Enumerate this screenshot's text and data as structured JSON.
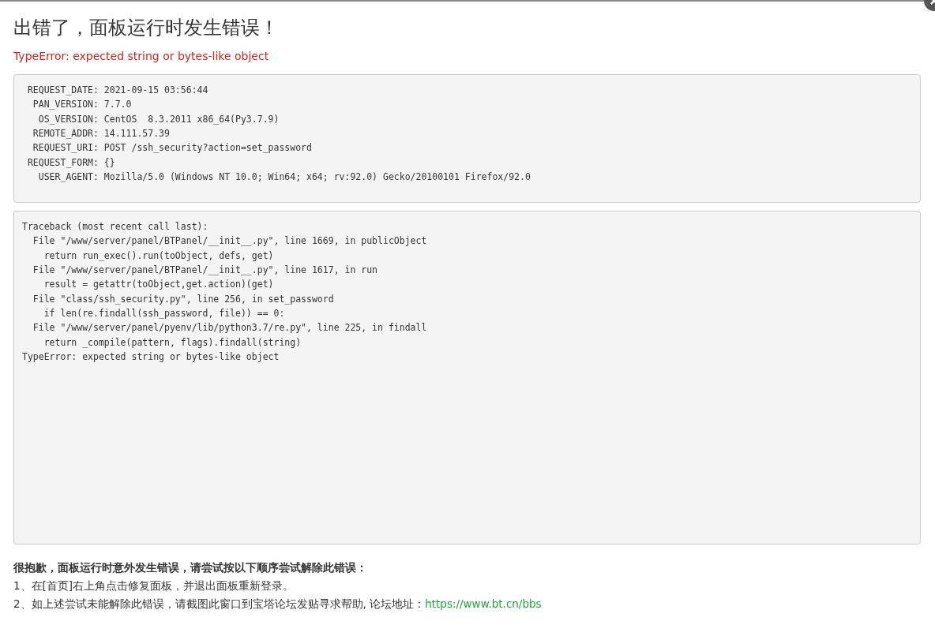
{
  "title": "出错了，面板运行时发生错误！",
  "error_message": "TypeError: expected string or bytes-like object",
  "request_info": [
    " REQUEST_DATE: 2021-09-15 03:56:44",
    "  PAN_VERSION: 7.7.0",
    "   OS_VERSION: CentOS  8.3.2011 x86_64(Py3.7.9)",
    "  REMOTE_ADDR: 14.111.57.39",
    "  REQUEST_URI: POST /ssh_security?action=set_password",
    " REQUEST_FORM: {}",
    "   USER_AGENT: Mozilla/5.0 (Windows NT 10.0; Win64; x64; rv:92.0) Gecko/20100101 Firefox/92.0"
  ],
  "traceback": [
    "Traceback (most recent call last):",
    "  File \"/www/server/panel/BTPanel/__init__.py\", line 1669, in publicObject",
    "    return run_exec().run(toObject, defs, get)",
    "  File \"/www/server/panel/BTPanel/__init__.py\", line 1617, in run",
    "    result = getattr(toObject,get.action)(get)",
    "  File \"class/ssh_security.py\", line 256, in set_password",
    "    if len(re.findall(ssh_password, file)) == 0:",
    "  File \"/www/server/panel/pyenv/lib/python3.7/re.py\", line 225, in findall",
    "    return _compile(pattern, flags).findall(string)",
    "TypeError: expected string or bytes-like object"
  ],
  "help": {
    "heading": "很抱歉，面板运行时意外发生错误，请尝试按以下顺序尝试解除此错误：",
    "steps": [
      {
        "text": "1、在[首页]右上角点击修复面板，并退出面板重新登录。"
      },
      {
        "text": "2、如上述尝试未能解除此错误，请截图此窗口到宝塔论坛发贴寻求帮助, 论坛地址：",
        "link": "https://www.bt.cn/bbs"
      }
    ]
  }
}
